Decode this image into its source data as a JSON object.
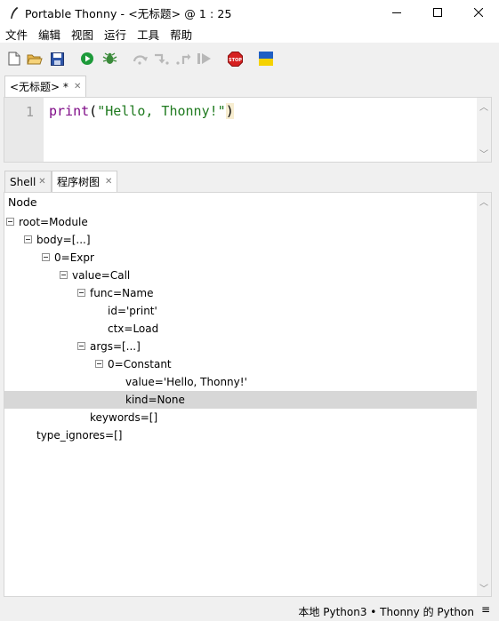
{
  "window": {
    "title": "Portable Thonny  -  <无标题>  @  1 : 25"
  },
  "menu": [
    "文件",
    "编辑",
    "视图",
    "运行",
    "工具",
    "帮助"
  ],
  "toolbar": {
    "icons": [
      "new-file-icon",
      "open-folder-icon",
      "save-icon",
      "run-icon",
      "debug-icon",
      "step-over-icon",
      "step-into-icon",
      "step-out-icon",
      "resume-icon",
      "stop-icon",
      "ukraine-flag-icon"
    ]
  },
  "editor": {
    "tab_label": "<无标题> *",
    "line_number": "1",
    "code": {
      "func": "print",
      "open": "(",
      "string": "\"Hello, Thonny!\"",
      "close": ")"
    }
  },
  "bottom_tabs": [
    {
      "label": "Shell"
    },
    {
      "label": "程序树图"
    }
  ],
  "tree": {
    "header": "Node",
    "nodes": [
      {
        "label": "root=Module",
        "level": 0,
        "toggle": true
      },
      {
        "label": "body=[...]",
        "level": 1,
        "toggle": true
      },
      {
        "label": "0=Expr",
        "level": 2,
        "toggle": true
      },
      {
        "label": "value=Call",
        "level": 3,
        "toggle": true
      },
      {
        "label": "func=Name",
        "level": 4,
        "toggle": true
      },
      {
        "label": "id='print'",
        "level": 5,
        "toggle": false
      },
      {
        "label": "ctx=Load",
        "level": 5,
        "toggle": false
      },
      {
        "label": "args=[...]",
        "level": 4,
        "toggle": true
      },
      {
        "label": "0=Constant",
        "level": 5,
        "toggle": true
      },
      {
        "label": "value='Hello, Thonny!'",
        "level": 6,
        "toggle": false
      },
      {
        "label": "kind=None",
        "level": 6,
        "toggle": false,
        "selected": true
      },
      {
        "label": "keywords=[]",
        "level": 4,
        "toggle": false
      },
      {
        "label": "type_ignores=[]",
        "level": 1,
        "toggle": false
      }
    ]
  },
  "status": {
    "interpreter": "本地 Python3  •  Thonny 的 Python",
    "menu_glyph": "≡"
  }
}
